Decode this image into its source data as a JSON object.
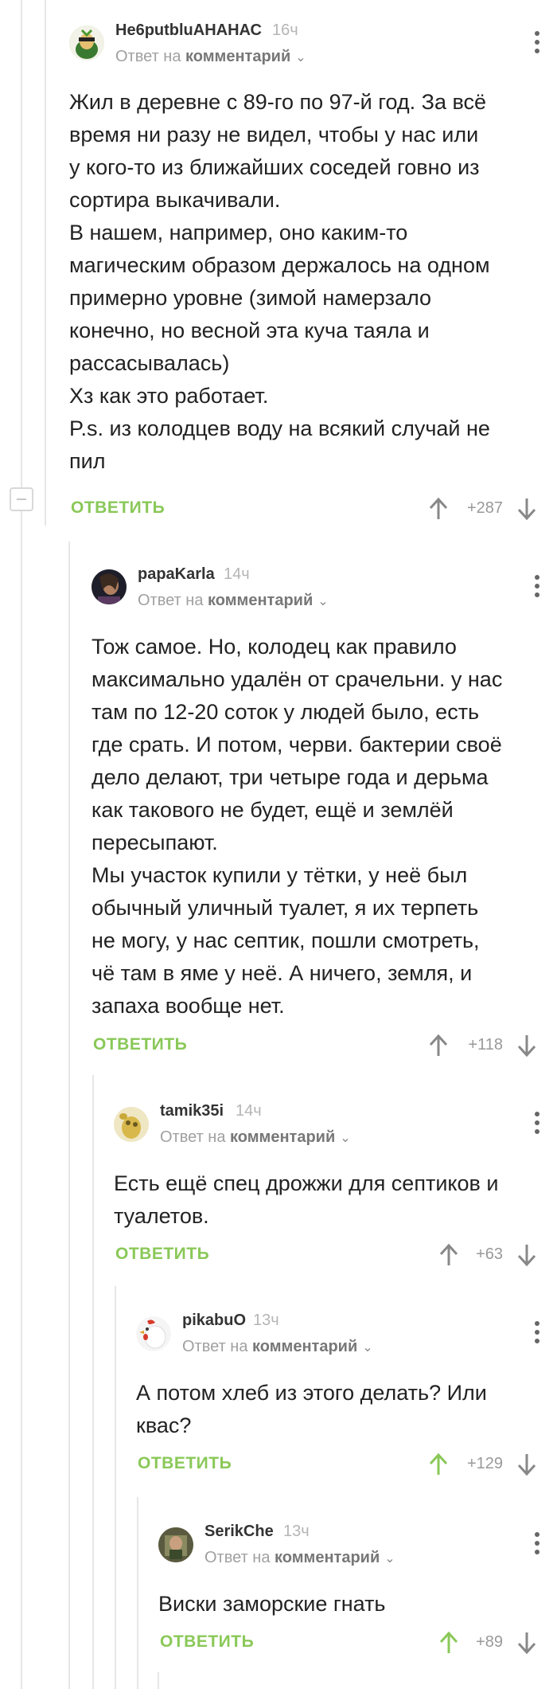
{
  "reply_to_prefix": "Ответ на",
  "reply_to_target": "комментарий",
  "reply_label": "ОТВЕТИТЬ",
  "colors": {
    "accent": "#8ac858",
    "vote_neutral": "#888888",
    "vote_up_active": "#8ac858"
  },
  "comments": [
    {
      "author": "Не6putbluАНАНАС",
      "time": "16ч",
      "lines": [
        "Жил в деревне с 89-го по 97-й год. За всё",
        "время ни разу не видел, чтобы у нас или",
        "у кого-то из ближайших соседей говно из",
        "сортира выкачивали.",
        "В нашем, например, оно каким-то",
        "магическим образом держалось на одном",
        "примерно уровне (зимой намерзало",
        "конечно, но весной эта куча таяла и",
        "рассасывалась)",
        "Хз как это работает.",
        "P.s. из колодцев воду на всякий случай не",
        "пил"
      ],
      "score": "+287"
    },
    {
      "author": "papaKarla",
      "time": "14ч",
      "lines": [
        "Тож самое. Но, колодец как правило",
        "максимально удалён от срачельни. у нас",
        "там по 12-20 соток у людей было, есть",
        "где срать. И потом, черви. бактерии своё",
        "дело делают, три четыре года и дерьма",
        "как такового не будет, ещё и землёй",
        "пересыпают.",
        "Мы участок купили у тётки, у неё был",
        "обычный уличный туалет, я их терпеть",
        "не могу, у нас септик, пошли смотреть,",
        "чё там в яме у неё. А ничего, земля, и",
        "запаха вообще нет."
      ],
      "score": "+118"
    },
    {
      "author": "tamik35i",
      "time": "14ч",
      "lines": [
        "Есть ещё спец дрожжи для септиков и",
        "туалетов."
      ],
      "score": "+63"
    },
    {
      "author": "pikabuO",
      "time": "13ч",
      "lines": [
        "А потом хлеб из этого делать? Или",
        "квас?"
      ],
      "score": "+129"
    },
    {
      "author": "SerikChe",
      "time": "13ч",
      "lines": [
        "Виски заморские гнать"
      ],
      "score": "+89"
    }
  ]
}
